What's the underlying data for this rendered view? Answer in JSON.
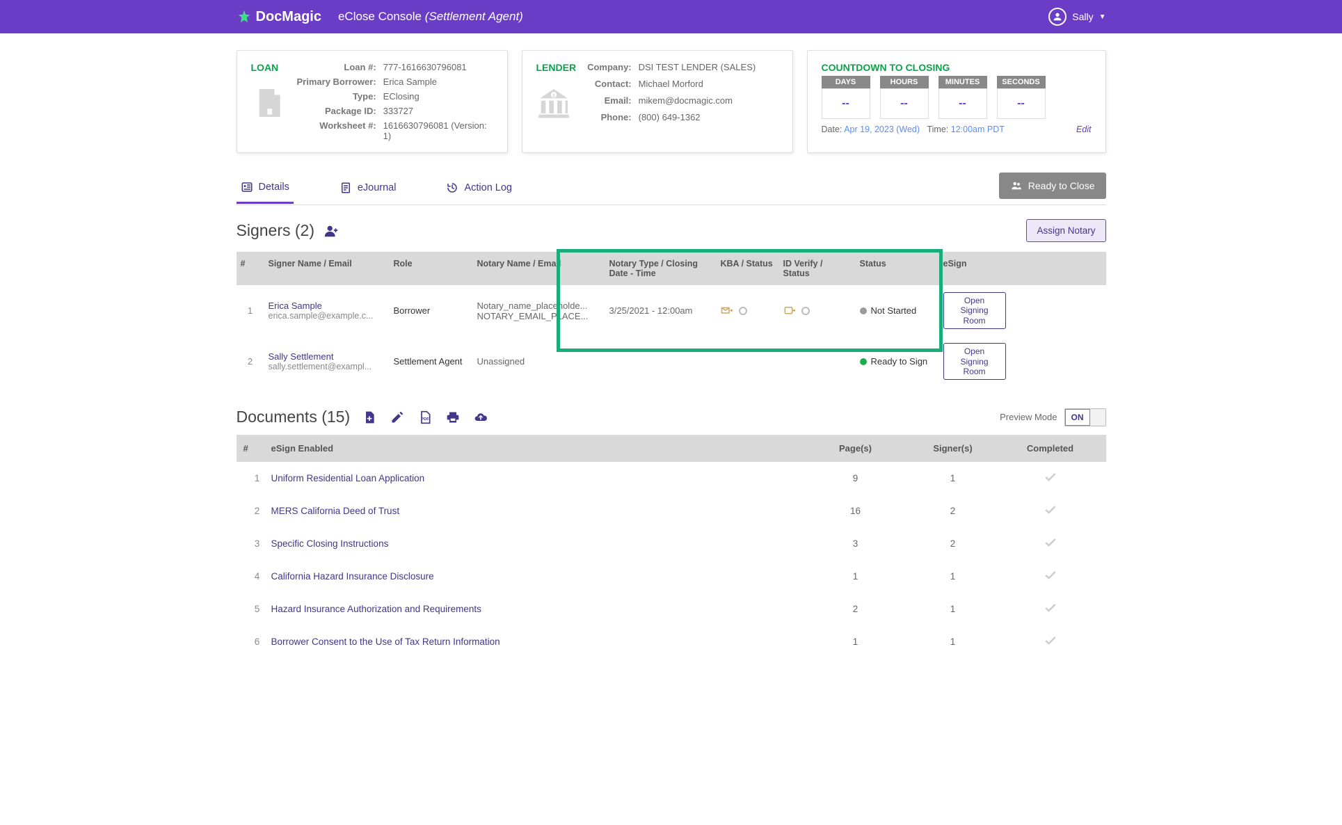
{
  "header": {
    "brand": "DocMagic",
    "console": "eClose Console",
    "role": "(Settlement Agent)",
    "user": "Sally"
  },
  "loan": {
    "title": "LOAN",
    "labels": {
      "loan_no": "Loan #:",
      "primary_borrower": "Primary Borrower:",
      "type": "Type:",
      "package_id": "Package ID:",
      "worksheet": "Worksheet #:"
    },
    "values": {
      "loan_no": "777-1616630796081",
      "primary_borrower": "Erica Sample",
      "type": "EClosing",
      "package_id": "333727",
      "worksheet": "1616630796081 (Version: 1)"
    }
  },
  "lender": {
    "title": "LENDER",
    "labels": {
      "company": "Company:",
      "contact": "Contact:",
      "email": "Email:",
      "phone": "Phone:"
    },
    "values": {
      "company": "DSI TEST LENDER (SALES)",
      "contact": "Michael Morford",
      "email": "mikem@docmagic.com",
      "phone": "(800) 649-1362"
    }
  },
  "countdown": {
    "title": "COUNTDOWN TO CLOSING",
    "headers": {
      "days": "DAYS",
      "hours": "HOURS",
      "minutes": "MINUTES",
      "seconds": "SECONDS"
    },
    "values": {
      "days": "--",
      "hours": "--",
      "minutes": "--",
      "seconds": "--"
    },
    "date_label": "Date:",
    "date_value": "Apr 19, 2023 (Wed)",
    "time_label": "Time:",
    "time_value": "12:00am PDT",
    "edit": "Edit"
  },
  "tabs": {
    "details": "Details",
    "ejournal": "eJournal",
    "actionlog": "Action Log",
    "ready_to_close": "Ready to Close"
  },
  "signers": {
    "title": "Signers (2)",
    "assign_notary": "Assign Notary",
    "headers": {
      "num": "#",
      "name_email": "Signer Name / Email",
      "role": "Role",
      "notary_name": "Notary Name / Email",
      "notary_type": "Notary Type / Closing Date - Time",
      "kba": "KBA / Status",
      "id_verify": "ID Verify / Status",
      "status": "Status",
      "esign": "eSign"
    },
    "rows": [
      {
        "num": "1",
        "name": "Erica Sample",
        "email": "erica.sample@example.c...",
        "role": "Borrower",
        "notary_name": "Notary_name_placeholde...",
        "notary_email": "NOTARY_EMAIL_PLACE...",
        "notary_type": "3/25/2021 - 12:00am",
        "status": "Not Started",
        "status_green": false,
        "esign": "Open Signing Room",
        "show_verify": true
      },
      {
        "num": "2",
        "name": "Sally Settlement",
        "email": "sally.settlement@exampl...",
        "role": "Settlement Agent",
        "notary_name": "Unassigned",
        "notary_email": "",
        "notary_type": "",
        "status": "Ready to Sign",
        "status_green": true,
        "esign": "Open Signing Room",
        "show_verify": false
      }
    ]
  },
  "documents": {
    "title": "Documents (15)",
    "preview_label": "Preview Mode",
    "toggle": "ON",
    "headers": {
      "num": "#",
      "name": "eSign Enabled",
      "pages": "Page(s)",
      "signers": "Signer(s)",
      "completed": "Completed"
    },
    "rows": [
      {
        "num": "1",
        "name": "Uniform Residential Loan Application",
        "pages": "9",
        "signers": "1"
      },
      {
        "num": "2",
        "name": "MERS California Deed of Trust",
        "pages": "16",
        "signers": "2"
      },
      {
        "num": "3",
        "name": "Specific Closing Instructions",
        "pages": "3",
        "signers": "2"
      },
      {
        "num": "4",
        "name": "California Hazard Insurance Disclosure",
        "pages": "1",
        "signers": "1"
      },
      {
        "num": "5",
        "name": "Hazard Insurance Authorization and Requirements",
        "pages": "2",
        "signers": "1"
      },
      {
        "num": "6",
        "name": "Borrower Consent to the Use of Tax Return Information",
        "pages": "1",
        "signers": "1"
      }
    ]
  }
}
